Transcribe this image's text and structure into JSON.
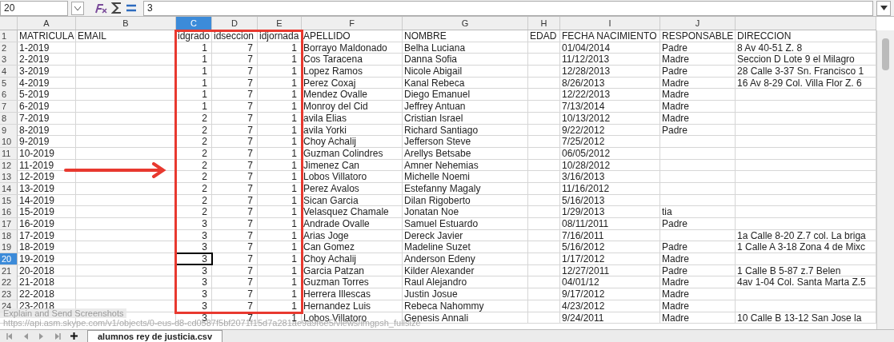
{
  "formula_bar": {
    "name_box": "20",
    "value": "3"
  },
  "columns": [
    {
      "letter": "A",
      "selected": false
    },
    {
      "letter": "B",
      "selected": false
    },
    {
      "letter": "C",
      "selected": true
    },
    {
      "letter": "D",
      "selected": false
    },
    {
      "letter": "E",
      "selected": false
    },
    {
      "letter": "F",
      "selected": false
    },
    {
      "letter": "G",
      "selected": false
    },
    {
      "letter": "H",
      "selected": false
    },
    {
      "letter": "I",
      "selected": false
    },
    {
      "letter": "J",
      "selected": false
    },
    {
      "selected": false
    }
  ],
  "rows": [
    {
      "number": "1",
      "selected": false,
      "kind": "header",
      "cells": [
        {
          "text": "MATRICULA"
        },
        {
          "text": "EMAIL"
        },
        {
          "text": "idgrado"
        },
        {
          "text": "idseccion"
        },
        {
          "text": "idjornada"
        },
        {
          "text": "APELLIDO"
        },
        {
          "text": "NOMBRE"
        },
        {
          "text": "EDAD"
        },
        {
          "text": "FECHA NACIMIENTO"
        },
        {
          "text": "RESPONSABLE"
        },
        {
          "text": "DIRECCION"
        }
      ]
    },
    {
      "number": "2",
      "selected": false,
      "kind": "data",
      "cells": [
        {
          "text": "1-2019"
        },
        {},
        {
          "text": "1"
        },
        {
          "text": "7"
        },
        {
          "text": "1"
        },
        {
          "text": "Borrayo Maldonado"
        },
        {
          "text": "Belha Luciana"
        },
        {},
        {
          "text": "01/04/2014"
        },
        {
          "text": "Padre"
        },
        {
          "text": "8 Av 40-51 Z. 8"
        }
      ]
    },
    {
      "number": "3",
      "selected": false,
      "kind": "data",
      "cells": [
        {
          "text": "2-2019"
        },
        {},
        {
          "text": "1"
        },
        {
          "text": "7"
        },
        {
          "text": "1"
        },
        {
          "text": "Cos Taracena"
        },
        {
          "text": "Danna Sofia"
        },
        {},
        {
          "text": "11/12/2013"
        },
        {
          "text": "Madre"
        },
        {
          "text": "Seccion D Lote 9 el Milagro"
        }
      ]
    },
    {
      "number": "4",
      "selected": false,
      "kind": "data",
      "cells": [
        {
          "text": "3-2019"
        },
        {},
        {
          "text": "1"
        },
        {
          "text": "7"
        },
        {
          "text": "1"
        },
        {
          "text": "Lopez Ramos"
        },
        {
          "text": "Nicole Abigail"
        },
        {},
        {
          "text": "12/28/2013"
        },
        {
          "text": "Padre"
        },
        {
          "text": "28 Calle 3-37 Sn. Francisco 1"
        }
      ]
    },
    {
      "number": "5",
      "selected": false,
      "kind": "data",
      "cells": [
        {
          "text": "4-2019"
        },
        {},
        {
          "text": "1"
        },
        {
          "text": "7"
        },
        {
          "text": "1"
        },
        {
          "text": "Perez Coxaj"
        },
        {
          "text": "Kanal Rebeca"
        },
        {},
        {
          "text": "8/26/2013"
        },
        {
          "text": "Madre"
        },
        {
          "text": "16 Av 8-29 Col. Villa Flor Z. 6"
        }
      ]
    },
    {
      "number": "6",
      "selected": false,
      "kind": "data",
      "cells": [
        {
          "text": "5-2019"
        },
        {},
        {
          "text": "1"
        },
        {
          "text": "7"
        },
        {
          "text": "1"
        },
        {
          "text": "Mendez Ovalle"
        },
        {
          "text": "Diego Emanuel"
        },
        {},
        {
          "text": "12/22/2013"
        },
        {
          "text": "Madre"
        },
        {}
      ]
    },
    {
      "number": "7",
      "selected": false,
      "kind": "data",
      "cells": [
        {
          "text": "6-2019"
        },
        {},
        {
          "text": "1"
        },
        {
          "text": "7"
        },
        {
          "text": "1"
        },
        {
          "text": "Monroy del Cid"
        },
        {
          "text": "Jeffrey Antuan"
        },
        {},
        {
          "text": "7/13/2014"
        },
        {
          "text": "Madre"
        },
        {}
      ]
    },
    {
      "number": "8",
      "selected": false,
      "kind": "data",
      "cells": [
        {
          "text": "7-2019"
        },
        {},
        {
          "text": "2"
        },
        {
          "text": "7"
        },
        {
          "text": "1"
        },
        {
          "text": "avila Elias"
        },
        {
          "text": "Cristian Israel"
        },
        {},
        {
          "text": "10/13/2012"
        },
        {
          "text": "Madre"
        },
        {}
      ]
    },
    {
      "number": "9",
      "selected": false,
      "kind": "data",
      "cells": [
        {
          "text": "8-2019"
        },
        {},
        {
          "text": "2"
        },
        {
          "text": "7"
        },
        {
          "text": "1"
        },
        {
          "text": "avila Yorki"
        },
        {
          "text": "Richard Santiago"
        },
        {},
        {
          "text": "9/22/2012"
        },
        {
          "text": "Padre"
        },
        {}
      ]
    },
    {
      "number": "10",
      "selected": false,
      "kind": "data",
      "cells": [
        {
          "text": "9-2019"
        },
        {},
        {
          "text": "2"
        },
        {
          "text": "7"
        },
        {
          "text": "1"
        },
        {
          "text": "Choy Achalij"
        },
        {
          "text": "Jefferson Steve"
        },
        {},
        {
          "text": "7/25/2012"
        },
        {},
        {}
      ]
    },
    {
      "number": "11",
      "selected": false,
      "kind": "data",
      "cells": [
        {
          "text": "10-2019"
        },
        {},
        {
          "text": "2"
        },
        {
          "text": "7"
        },
        {
          "text": "1"
        },
        {
          "text": "Guzman Colindres"
        },
        {
          "text": "Arellys Betsabe"
        },
        {},
        {
          "text": "06/05/2012"
        },
        {},
        {}
      ]
    },
    {
      "number": "12",
      "selected": false,
      "kind": "data",
      "cells": [
        {
          "text": "11-2019"
        },
        {},
        {
          "text": "2"
        },
        {
          "text": "7"
        },
        {
          "text": "1"
        },
        {
          "text": "Jimenez Can"
        },
        {
          "text": "Amner Nehemias"
        },
        {},
        {
          "text": "10/28/2012"
        },
        {},
        {}
      ]
    },
    {
      "number": "13",
      "selected": false,
      "kind": "data",
      "cells": [
        {
          "text": "12-2019"
        },
        {},
        {
          "text": "2"
        },
        {
          "text": "7"
        },
        {
          "text": "1"
        },
        {
          "text": "Lobos Villatoro"
        },
        {
          "text": "Michelle Noemi"
        },
        {},
        {
          "text": "3/16/2013"
        },
        {},
        {}
      ]
    },
    {
      "number": "14",
      "selected": false,
      "kind": "data",
      "cells": [
        {
          "text": "13-2019"
        },
        {},
        {
          "text": "2"
        },
        {
          "text": "7"
        },
        {
          "text": "1"
        },
        {
          "text": "Perez Avalos"
        },
        {
          "text": "Estefanny Magaly"
        },
        {},
        {
          "text": "11/16/2012"
        },
        {},
        {}
      ]
    },
    {
      "number": "15",
      "selected": false,
      "kind": "data",
      "cells": [
        {
          "text": "14-2019"
        },
        {},
        {
          "text": "2"
        },
        {
          "text": "7"
        },
        {
          "text": "1"
        },
        {
          "text": "Sican Garcia"
        },
        {
          "text": "Dilan Rigoberto"
        },
        {},
        {
          "text": "5/16/2013"
        },
        {},
        {}
      ]
    },
    {
      "number": "16",
      "selected": false,
      "kind": "data",
      "cells": [
        {
          "text": "15-2019"
        },
        {},
        {
          "text": "2"
        },
        {
          "text": "7"
        },
        {
          "text": "1"
        },
        {
          "text": "Velasquez Chamale"
        },
        {
          "text": "Jonatan Noe"
        },
        {},
        {
          "text": "1/29/2013"
        },
        {
          "text": "tia"
        },
        {}
      ]
    },
    {
      "number": "17",
      "selected": false,
      "kind": "data",
      "cells": [
        {
          "text": "16-2019"
        },
        {},
        {
          "text": "3"
        },
        {
          "text": "7"
        },
        {
          "text": "1"
        },
        {
          "text": "Andrade Ovalle"
        },
        {
          "text": "Samuel Estuardo"
        },
        {},
        {
          "text": "08/11/2011"
        },
        {
          "text": "Padre"
        },
        {}
      ]
    },
    {
      "number": "18",
      "selected": false,
      "kind": "data",
      "cells": [
        {
          "text": "17-2019"
        },
        {},
        {
          "text": "3"
        },
        {
          "text": "7"
        },
        {
          "text": "1"
        },
        {
          "text": "Arias Joge"
        },
        {
          "text": "Dereck Javier"
        },
        {},
        {
          "text": "7/16/2011"
        },
        {},
        {
          "text": "1a Calle 8-20 Z.7 col. La briga"
        }
      ]
    },
    {
      "number": "19",
      "selected": false,
      "kind": "data",
      "cells": [
        {
          "text": "18-2019"
        },
        {},
        {
          "text": "3"
        },
        {
          "text": "7"
        },
        {
          "text": "1"
        },
        {
          "text": "Can Gomez"
        },
        {
          "text": "Madeline Suzet"
        },
        {},
        {
          "text": "5/16/2012"
        },
        {
          "text": "Padre"
        },
        {
          "text": "1 Calle A 3-18 Zona 4 de Mixc"
        }
      ]
    },
    {
      "number": "20",
      "selected": true,
      "kind": "data",
      "cells": [
        {
          "text": "19-2019"
        },
        {},
        {
          "text": "3"
        },
        {
          "text": "7"
        },
        {
          "text": "1"
        },
        {
          "text": "Choy Achalij"
        },
        {
          "text": "Anderson Edeny"
        },
        {},
        {
          "text": "1/17/2012"
        },
        {
          "text": "Madre"
        },
        {}
      ]
    },
    {
      "number": "21",
      "selected": false,
      "kind": "data",
      "cells": [
        {
          "text": "20-2018"
        },
        {},
        {
          "text": "3"
        },
        {
          "text": "7"
        },
        {
          "text": "1"
        },
        {
          "text": "Garcia Patzan"
        },
        {
          "text": "Kilder Alexander"
        },
        {},
        {
          "text": "12/27/2011"
        },
        {
          "text": "Padre"
        },
        {
          "text": "1 Calle B 5-87 z.7 Belen"
        }
      ]
    },
    {
      "number": "22",
      "selected": false,
      "kind": "data",
      "cells": [
        {
          "text": "21-2018"
        },
        {},
        {
          "text": "3"
        },
        {
          "text": "7"
        },
        {
          "text": "1"
        },
        {
          "text": "Guzman Torres"
        },
        {
          "text": "Raul Alejandro"
        },
        {},
        {
          "text": "04/01/12"
        },
        {
          "text": "Madre"
        },
        {
          "text": "4av 1-04 Col. Santa Marta Z.5"
        }
      ]
    },
    {
      "number": "23",
      "selected": false,
      "kind": "data",
      "cells": [
        {
          "text": "22-2018"
        },
        {},
        {
          "text": "3"
        },
        {
          "text": "7"
        },
        {
          "text": "1"
        },
        {
          "text": "Herrera Illescas"
        },
        {
          "text": "Justin Josue"
        },
        {},
        {
          "text": "9/17/2012"
        },
        {
          "text": "Madre"
        },
        {}
      ]
    },
    {
      "number": "24",
      "selected": false,
      "kind": "data",
      "cells": [
        {
          "text": "23-2018"
        },
        {},
        {
          "text": "3"
        },
        {
          "text": "7"
        },
        {
          "text": "1"
        },
        {
          "text": "Hernandez Luis"
        },
        {
          "text": "Rebeca Nahommy"
        },
        {},
        {
          "text": "4/23/2012"
        },
        {
          "text": "Madre"
        },
        {}
      ]
    },
    {
      "kind": "data",
      "cells": [
        {},
        {},
        {
          "text": "3"
        },
        {
          "text": "7"
        },
        {
          "text": "1"
        },
        {
          "text": "Lobos Villatoro"
        },
        {
          "text": "Genesis Annali"
        },
        {},
        {
          "text": "9/24/2011"
        },
        {
          "text": "Madre"
        },
        {
          "text": "10 Calle B 13-12 San Jose la"
        }
      ]
    }
  ],
  "tooltip": {
    "title": "Explain and Send Screenshots",
    "url": "https://api.asm.skype.com/v1/objects/0-eus-d8-cd0587f5bf2071f15d7a281ae9a9f6e5/views/imgpsh_fullsize"
  },
  "sheet_tabs": [
    {
      "label": "alumnos rey de justicia.csv",
      "selected": true
    }
  ]
}
